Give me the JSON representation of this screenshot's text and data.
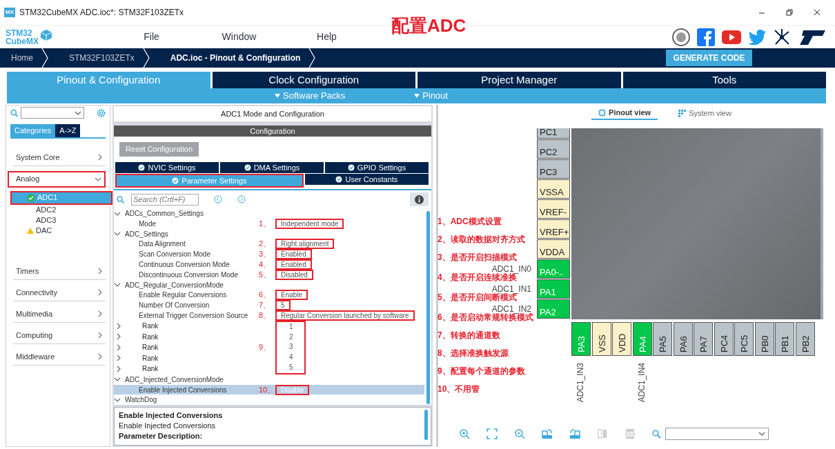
{
  "window": {
    "app_icon": "MX",
    "title": "STM32CubeMX ADC.ioc*: STM32F103ZETx"
  },
  "logo": {
    "line1": "STM32",
    "line2": "CubeMX"
  },
  "menu": [
    "File",
    "Window",
    "Help"
  ],
  "headline": "配置ADC",
  "breadcrumbs": [
    {
      "label": "Home",
      "current": false
    },
    {
      "label": "STM32F103ZETx",
      "current": false
    },
    {
      "label": "ADC.ioc - Pinout & Configuration",
      "current": true
    }
  ],
  "generate_button": "GENERATE CODE",
  "main_tabs": [
    {
      "label": "Pinout & Configuration",
      "selected": true
    },
    {
      "label": "Clock Configuration",
      "selected": false
    },
    {
      "label": "Project Manager",
      "selected": false
    },
    {
      "label": "Tools",
      "selected": false
    }
  ],
  "sub_menu": [
    "Software Packs",
    "Pinout"
  ],
  "sidebar": {
    "tabs": [
      {
        "label": "Categories",
        "selected": true
      },
      {
        "label": "A->Z",
        "selected": false
      }
    ],
    "categories": [
      {
        "label": "System Core",
        "expanded": false,
        "highlighted": false
      },
      {
        "label": "Analog",
        "expanded": true,
        "highlighted": true,
        "children": [
          {
            "label": "ADC1",
            "configured": true,
            "warning": false,
            "selected": true,
            "highlighted": true
          },
          {
            "label": "ADC2",
            "configured": false,
            "warning": false,
            "selected": false,
            "highlighted": false
          },
          {
            "label": "ADC3",
            "configured": false,
            "warning": false,
            "selected": false,
            "highlighted": false
          },
          {
            "label": "DAC",
            "configured": false,
            "warning": true,
            "selected": false,
            "highlighted": false
          }
        ]
      },
      {
        "label": "Timers",
        "expanded": false,
        "highlighted": false
      },
      {
        "label": "Connectivity",
        "expanded": false,
        "highlighted": false
      },
      {
        "label": "Multimedia",
        "expanded": false,
        "highlighted": false
      },
      {
        "label": "Computing",
        "expanded": false,
        "highlighted": false
      },
      {
        "label": "Middleware",
        "expanded": false,
        "highlighted": false
      }
    ]
  },
  "config": {
    "title": "ADC1 Mode and Configuration",
    "section": "Configuration",
    "reset_button": "Reset Configuration",
    "tabs_row1": [
      {
        "label": "NVIC Settings",
        "selected": false,
        "highlighted": false
      },
      {
        "label": "DMA Settings",
        "selected": false,
        "highlighted": false
      },
      {
        "label": "GPIO Settings",
        "selected": false,
        "highlighted": false
      }
    ],
    "tabs_row2": [
      {
        "label": "Parameter Settings",
        "selected": true,
        "highlighted": true
      },
      {
        "label": "User Constants",
        "selected": false,
        "highlighted": false
      }
    ],
    "search_placeholder": "Search (Crtl+F)",
    "groups": [
      {
        "label": "ADCs_Common_Settings",
        "expanded": true,
        "items": [
          {
            "label": "Mode",
            "mark": "1、",
            "value": "Independent mode",
            "highlighted": true,
            "selected": false
          }
        ]
      },
      {
        "label": "ADC_Settings",
        "expanded": true,
        "items": [
          {
            "label": "Data Alignment",
            "mark": "2、",
            "value": "Right alignment",
            "highlighted": true,
            "selected": false
          },
          {
            "label": "Scan Conversion Mode",
            "mark": "3、",
            "value": "Enabled",
            "highlighted": true,
            "selected": false
          },
          {
            "label": "Continuous Conversion Mode",
            "mark": "4、",
            "value": "Enabled",
            "highlighted": true,
            "selected": false
          },
          {
            "label": "Discontinuous Conversion Mode",
            "mark": "5、",
            "value": "Disabled",
            "highlighted": true,
            "selected": false
          }
        ]
      },
      {
        "label": "ADC_Regular_ConversionMode",
        "expanded": true,
        "items": [
          {
            "label": "Enable Regular Conversions",
            "mark": "6、",
            "value": "Enable",
            "highlighted": true,
            "selected": false
          },
          {
            "label": "Number Of Conversion",
            "mark": "7、",
            "value": "5",
            "highlighted": true,
            "selected": false
          },
          {
            "label": "External Trigger Conversion Source",
            "mark": "8、",
            "value": "Regular Conversion launched by software",
            "highlighted": true,
            "selected": false
          }
        ],
        "rank_block": {
          "mark": "9、",
          "highlighted": true
        },
        "ranks": [
          {
            "label": "Rank",
            "value": "1",
            "expanded": false
          },
          {
            "label": "Rank",
            "value": "2",
            "expanded": false
          },
          {
            "label": "Rank",
            "value": "3",
            "expanded": false
          },
          {
            "label": "Rank",
            "value": "4",
            "expanded": false
          },
          {
            "label": "Rank",
            "value": "5",
            "expanded": false
          }
        ]
      },
      {
        "label": "ADC_Injected_ConversionMode",
        "expanded": true,
        "items": [
          {
            "label": "Enable Injected Conversions",
            "mark": "10、",
            "value": "Disable",
            "highlighted": true,
            "selected": true
          }
        ]
      },
      {
        "label": "WatchDog",
        "expanded": true
      }
    ],
    "description": [
      {
        "kind": "heading",
        "text": "Enable Injected Conversions"
      },
      {
        "kind": "text",
        "text": "Enable Injected Conversions"
      },
      {
        "kind": "heading",
        "text": "Parameter Description:"
      }
    ]
  },
  "pinout": {
    "view_tabs": [
      {
        "label": "Pinout view",
        "selected": true
      },
      {
        "label": "System view",
        "selected": false
      }
    ],
    "left_pins": [
      {
        "label": "PC1",
        "kind": "io"
      },
      {
        "label": "PC2",
        "kind": "io"
      },
      {
        "label": "PC3",
        "kind": "io"
      },
      {
        "label": "VSSA",
        "kind": "power"
      },
      {
        "label": "VREF-",
        "kind": "power"
      },
      {
        "label": "VREF+",
        "kind": "power"
      },
      {
        "label": "VDDA",
        "kind": "power"
      },
      {
        "label": "PA0-..",
        "kind": "active",
        "signal": "ADC1_IN0"
      },
      {
        "label": "PA1",
        "kind": "active",
        "signal": "ADC1_IN1"
      },
      {
        "label": "PA2",
        "kind": "active",
        "signal": "ADC1_IN2"
      }
    ],
    "bottom_pins": [
      {
        "label": "PA3",
        "kind": "active",
        "signal": "ADC1_IN3"
      },
      {
        "label": "VSS",
        "kind": "power"
      },
      {
        "label": "VDD",
        "kind": "power"
      },
      {
        "label": "PA4",
        "kind": "active",
        "signal": "ADC1_IN4"
      },
      {
        "label": "PA5",
        "kind": "io"
      },
      {
        "label": "PA6",
        "kind": "io"
      },
      {
        "label": "PA7",
        "kind": "io"
      },
      {
        "label": "PC4",
        "kind": "io"
      },
      {
        "label": "PC5",
        "kind": "io"
      },
      {
        "label": "PB0",
        "kind": "io"
      },
      {
        "label": "PB1",
        "kind": "io"
      },
      {
        "label": "PB2",
        "kind": "io"
      }
    ]
  },
  "notes": [
    {
      "number": "1、",
      "text": "ADC模式设置"
    },
    {
      "number": "2、",
      "text": "读取的数据对齐方式"
    },
    {
      "number": "3、",
      "text": "是否开启扫描模式"
    },
    {
      "number": "4、",
      "text": "是否开启连续准换"
    },
    {
      "number": "5、",
      "text": "是否开启间断模式"
    },
    {
      "number": "6、",
      "text": "是否启动常规转换模式"
    },
    {
      "number": "7、",
      "text": "转换的通道数"
    },
    {
      "number": "8、",
      "text": "选择准换触发源"
    },
    {
      "number": "9、",
      "text": "配置每个通道的参数"
    },
    {
      "number": "10、",
      "text": "不用管"
    }
  ]
}
